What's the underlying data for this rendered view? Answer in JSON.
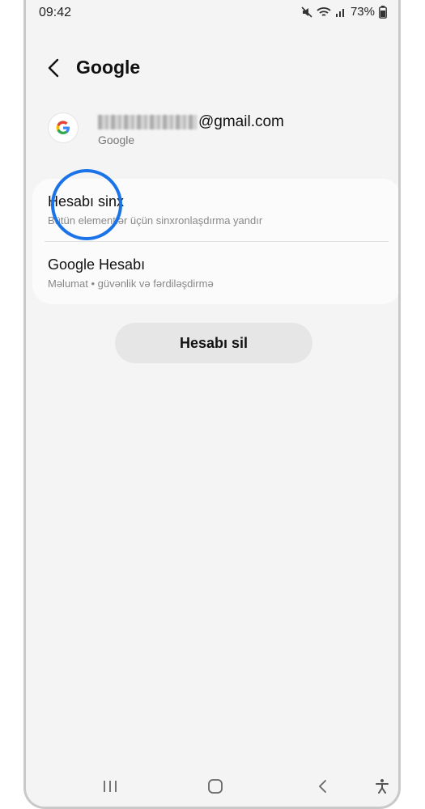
{
  "status_bar": {
    "time": "09:42",
    "battery": "73%"
  },
  "header": {
    "title": "Google"
  },
  "account": {
    "email_suffix": "@gmail.com",
    "provider": "Google"
  },
  "settings": [
    {
      "title": "Hesabı sinx",
      "subtitle": "Bütün elementlər üçün sinxronlaşdırma yandır"
    },
    {
      "title": "Google Hesabı",
      "subtitle": "Məlumat • güvənlik və fərdiləşdirmə"
    }
  ],
  "actions": {
    "remove_account": "Hesabı sil"
  },
  "colors": {
    "accent_ring": "#1a73e8",
    "background": "#f4f4f4"
  },
  "icons": [
    "mute-icon",
    "wifi-icon",
    "signal-icon",
    "battery-icon",
    "back-arrow-icon",
    "google-logo-icon",
    "recent-apps-icon",
    "home-icon",
    "back-icon",
    "accessibility-icon"
  ]
}
